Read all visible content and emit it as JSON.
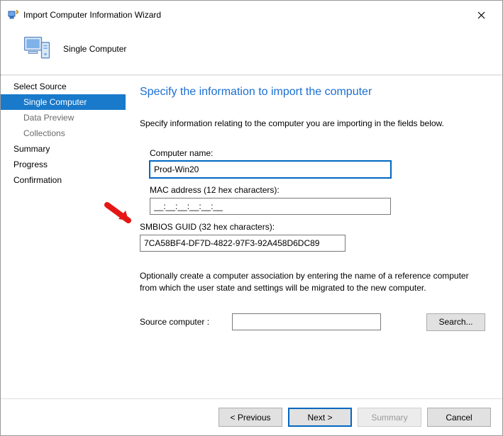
{
  "window": {
    "title": "Import Computer Information Wizard"
  },
  "header": {
    "subtitle": "Single Computer"
  },
  "sidebar": {
    "items": [
      {
        "label": "Select Source"
      },
      {
        "label": "Single Computer"
      },
      {
        "label": "Data Preview"
      },
      {
        "label": "Collections"
      },
      {
        "label": "Summary"
      },
      {
        "label": "Progress"
      },
      {
        "label": "Confirmation"
      }
    ]
  },
  "page": {
    "title": "Specify the information to import the computer",
    "intro": "Specify information relating to the computer you are importing in the fields below.",
    "computer_name_label": "Computer name:",
    "computer_name_value": "Prod-Win20",
    "mac_label": "MAC address (12 hex characters):",
    "mac_value": "__:__:__:__:__:__",
    "guid_label": "SMBIOS GUID (32 hex characters):",
    "guid_value": "7CA58BF4-DF7D-4822-97F3-92A458D6DC89",
    "note": "Optionally create a computer association by entering the name of a reference computer from which the user state and settings will be migrated to the new computer.",
    "source_label": "Source computer :",
    "source_value": "",
    "search_btn": "Search..."
  },
  "footer": {
    "previous": "< Previous",
    "next": "Next >",
    "summary": "Summary",
    "cancel": "Cancel"
  }
}
